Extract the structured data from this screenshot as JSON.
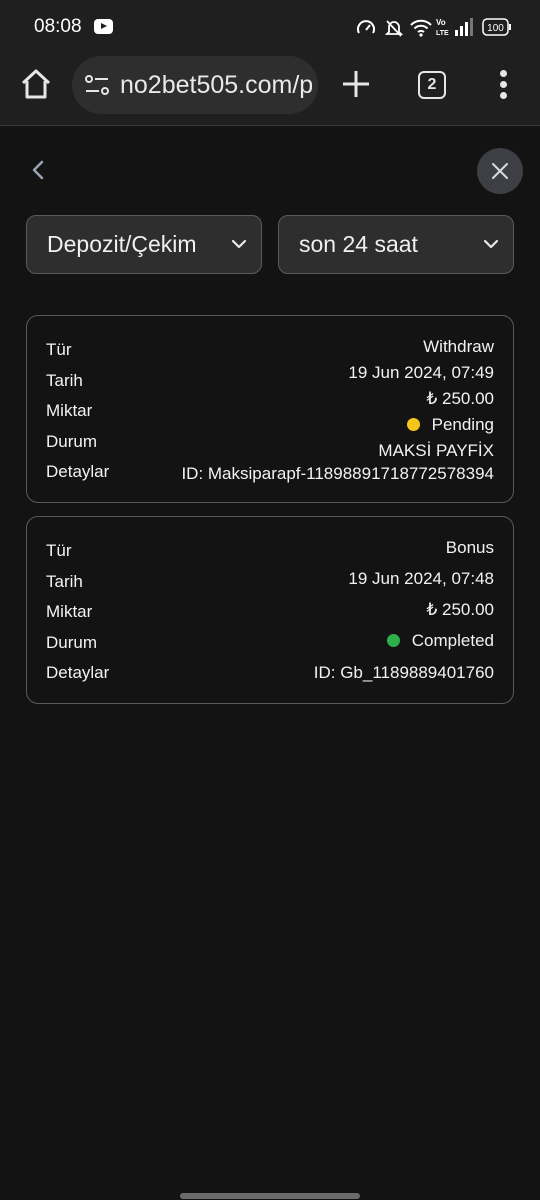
{
  "status_bar": {
    "time": "08:08",
    "battery": "100"
  },
  "browser": {
    "url": "no2bet505.com/p",
    "tab_count": "2"
  },
  "filters": {
    "type": "Depozit/Çekim",
    "period": "son 24 saat"
  },
  "transactions": [
    {
      "labels": {
        "type": "Tür",
        "date": "Tarih",
        "amount": "Miktar",
        "status": "Durum",
        "details": "Detaylar"
      },
      "type": "Withdraw",
      "date": "19 Jun 2024, 07:49",
      "amount": "₺ 250.00",
      "status": "Pending",
      "status_color": "#f5c518",
      "method": "MAKSİ PAYFİX",
      "id": "ID: Maksiparapf-11898891718772578394"
    },
    {
      "labels": {
        "type": "Tür",
        "date": "Tarih",
        "amount": "Miktar",
        "status": "Durum",
        "details": "Detaylar"
      },
      "type": "Bonus",
      "date": "19 Jun 2024, 07:48",
      "amount": "₺ 250.00",
      "status": "Completed",
      "status_color": "#2db04a",
      "id": "ID: Gb_1189889401760"
    }
  ],
  "icons": [
    "youtube-icon",
    "speed-icon",
    "mute-icon",
    "wifi-icon",
    "volte-icon",
    "signal-icon",
    "battery-icon",
    "home-icon",
    "site-settings-icon",
    "plus-icon",
    "menu-icon",
    "chevron-left-icon",
    "close-icon",
    "chevron-down-icon"
  ]
}
